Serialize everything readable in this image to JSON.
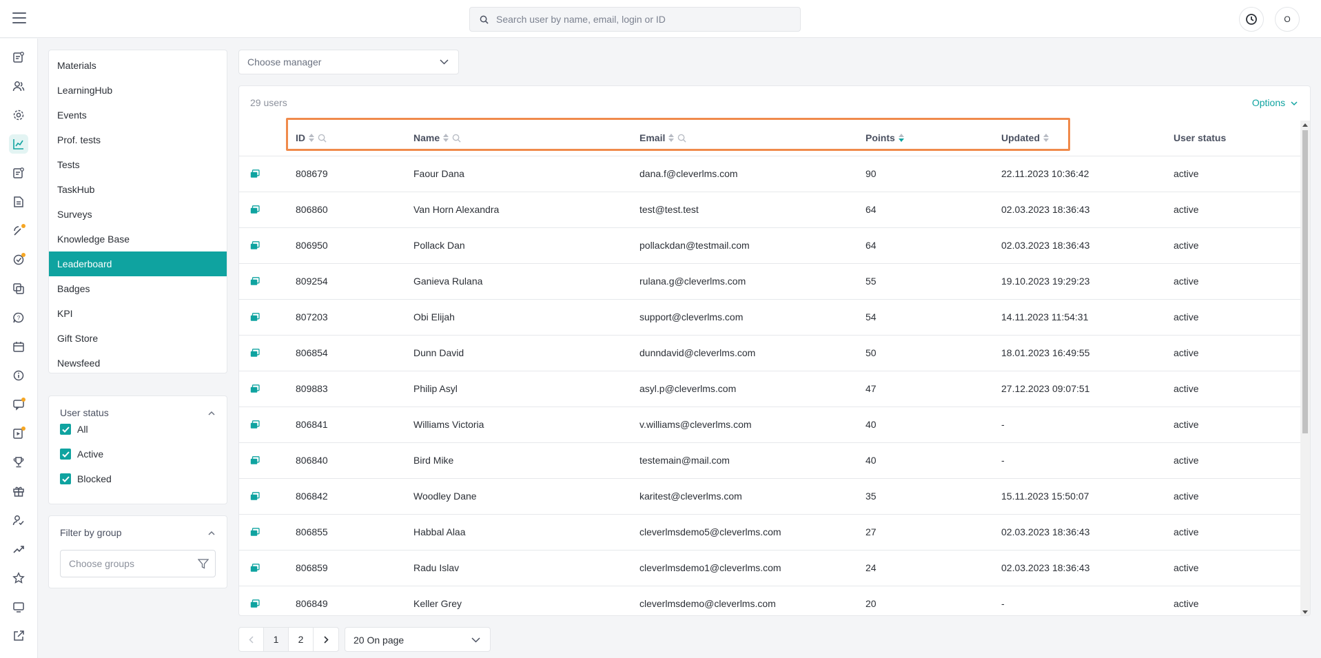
{
  "search": {
    "placeholder": "Search user by name, email, login or ID"
  },
  "header": {
    "avatar_initial": "O"
  },
  "side_menu": {
    "items": [
      "Materials",
      "LearningHub",
      "Events",
      "Prof. tests",
      "Tests",
      "TaskHub",
      "Surveys",
      "Knowledge Base",
      "Leaderboard",
      "Badges",
      "KPI",
      "Gift Store",
      "Newsfeed"
    ],
    "active": "Leaderboard"
  },
  "user_status_filter": {
    "title": "User status",
    "options": [
      "All",
      "Active",
      "Blocked"
    ]
  },
  "group_filter": {
    "title": "Filter by group",
    "placeholder": "Choose groups"
  },
  "manager_select": {
    "placeholder": "Choose manager"
  },
  "table": {
    "count_label": "29 users",
    "options_label": "Options",
    "columns": [
      "ID",
      "Name",
      "Email",
      "Points",
      "Updated",
      "User status"
    ],
    "rows": [
      [
        "808679",
        "Faour Dana",
        "dana.f@cleverlms.com",
        "90",
        "22.11.2023 10:36:42",
        "active"
      ],
      [
        "806860",
        "Van Horn Alexandra",
        "test@test.test",
        "64",
        "02.03.2023 18:36:43",
        "active"
      ],
      [
        "806950",
        "Pollack Dan",
        "pollackdan@testmail.com",
        "64",
        "02.03.2023 18:36:43",
        "active"
      ],
      [
        "809254",
        "Ganieva Rulana",
        "rulana.g@cleverlms.com",
        "55",
        "19.10.2023 19:29:23",
        "active"
      ],
      [
        "807203",
        "Obi Elijah",
        "support@cleverlms.com",
        "54",
        "14.11.2023 11:54:31",
        "active"
      ],
      [
        "806854",
        "Dunn David",
        "dunndavid@cleverlms.com",
        "50",
        "18.01.2023 16:49:55",
        "active"
      ],
      [
        "809883",
        "Philip Asyl",
        "asyl.p@cleverlms.com",
        "47",
        "27.12.2023 09:07:51",
        "active"
      ],
      [
        "806841",
        "Williams Victoria",
        "v.williams@cleverlms.com",
        "40",
        "-",
        "active"
      ],
      [
        "806840",
        "Bird Mike",
        "testemain@mail.com",
        "40",
        "-",
        "active"
      ],
      [
        "806842",
        "Woodley Dane",
        "karitest@cleverlms.com",
        "35",
        "15.11.2023 15:50:07",
        "active"
      ],
      [
        "806855",
        "Habbal Alaa",
        "cleverlmsdemo5@cleverlms.com",
        "27",
        "02.03.2023 18:36:43",
        "active"
      ],
      [
        "806859",
        "Radu Islav",
        "cleverlmsdemo1@cleverlms.com",
        "24",
        "02.03.2023 18:36:43",
        "active"
      ],
      [
        "806849",
        "Keller Grey",
        "cleverlmsdemo@cleverlms.com",
        "20",
        "-",
        "active"
      ]
    ]
  },
  "pagination": {
    "pages": [
      "1",
      "2"
    ],
    "current": "1",
    "per_page": "20 On page"
  },
  "colors": {
    "accent": "#0fa3a0",
    "highlight": "#f08a4b",
    "badge": "#f5a623"
  }
}
